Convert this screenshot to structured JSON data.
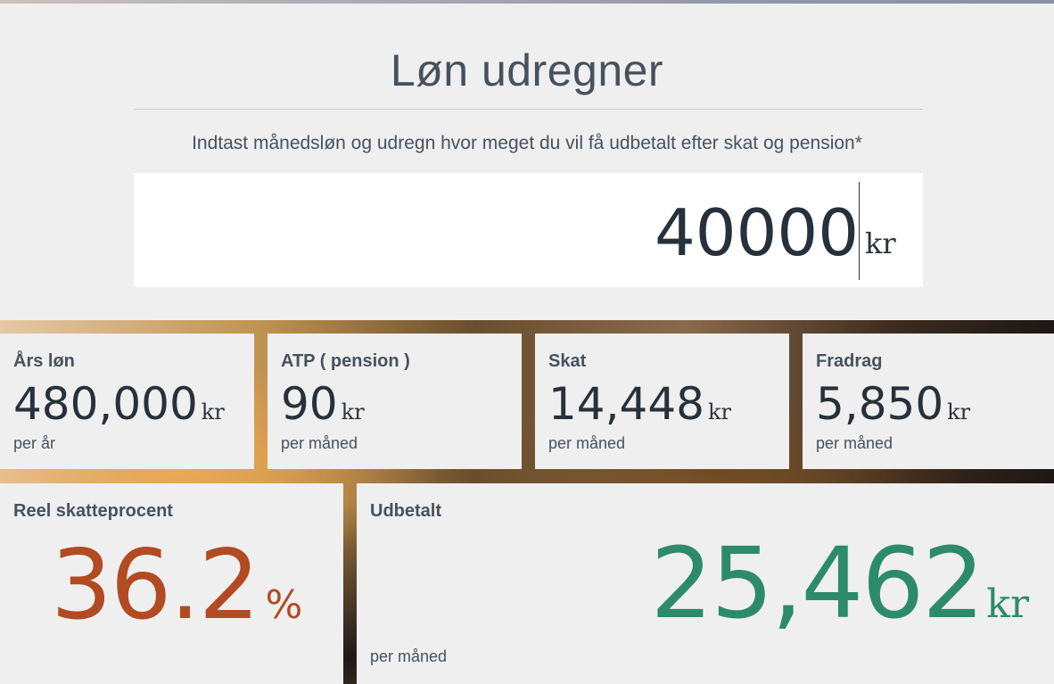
{
  "header": {
    "title": "Løn udregner",
    "subtitle": "Indtast månedsløn og udregn hvor meget du vil få udbetalt efter skat og pension*"
  },
  "salary_input": {
    "value": "40000",
    "unit": "kr"
  },
  "cards": {
    "annual": {
      "label": "Års løn",
      "value": "480,000",
      "unit": "kr",
      "period": "per år"
    },
    "atp": {
      "label": "ATP ( pension )",
      "value": "90",
      "unit": "kr",
      "period": "per måned"
    },
    "tax": {
      "label": "Skat",
      "value": "14,448",
      "unit": "kr",
      "period": "per måned"
    },
    "deduction": {
      "label": "Fradrag",
      "value": "5,850",
      "unit": "kr",
      "period": "per måned"
    },
    "effective_tax": {
      "label": "Reel skatteprocent",
      "value": "36.2",
      "unit": "%"
    },
    "payout": {
      "label": "Udbetalt",
      "value": "25,462",
      "unit": "kr",
      "period": "per måned"
    }
  },
  "colors": {
    "tax_rate": "#b24a22",
    "payout": "#2c8b6a",
    "text": "#46525e",
    "card_bg": "#efefef"
  }
}
